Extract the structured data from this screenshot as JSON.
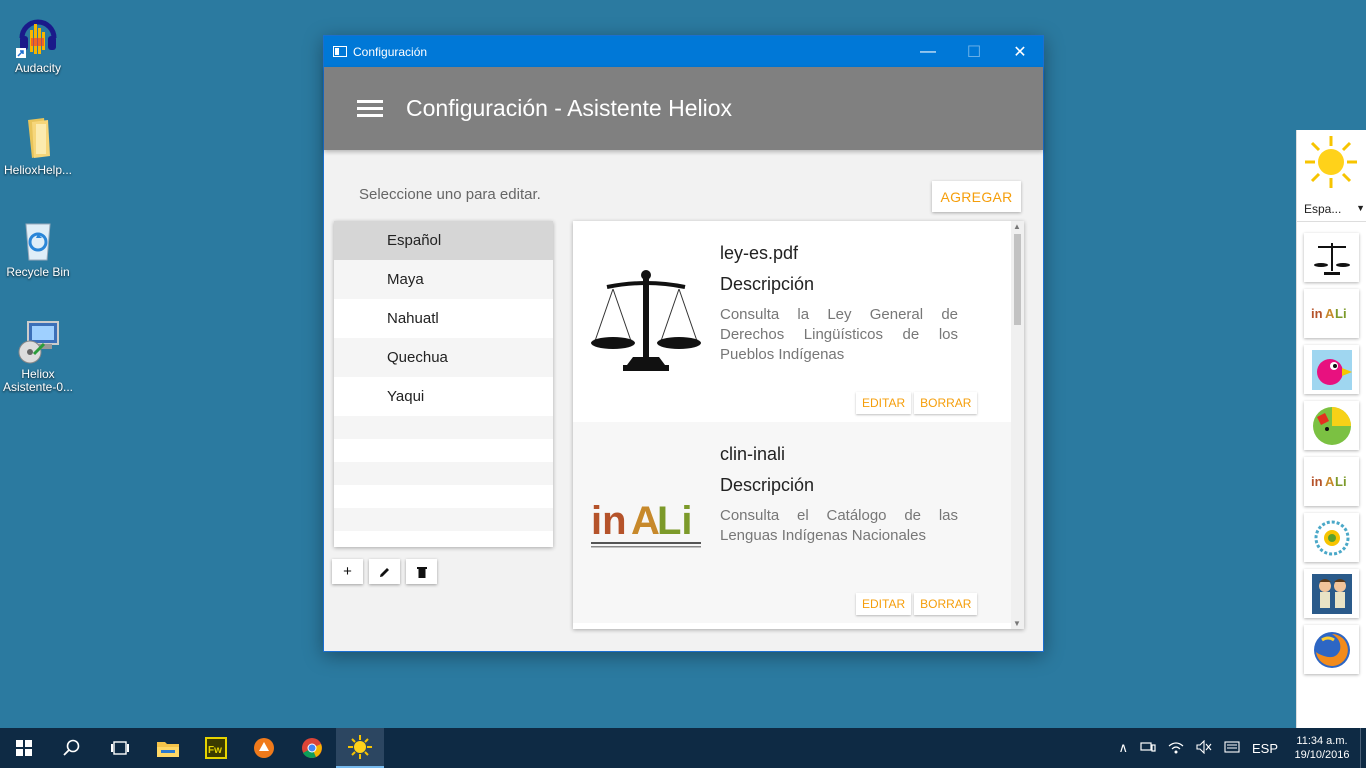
{
  "desktop": {
    "icons": [
      {
        "label": "Audacity"
      },
      {
        "label": "HelioxHelp..."
      },
      {
        "label": "Recycle Bin"
      },
      {
        "label": "Heliox Asistente-0..."
      }
    ]
  },
  "window": {
    "title": "Configuración",
    "controls": {
      "minimize": "—",
      "maximize": "☐",
      "close": "✕"
    },
    "app_title": "Configuración - Asistente Heliox",
    "hint": "Seleccione uno para editar.",
    "add_label": "AGREGAR",
    "languages": [
      "Español",
      "Maya",
      "Nahuatl",
      "Quechua",
      "Yaqui"
    ],
    "selected_language": "Español",
    "tools": {
      "add": "+",
      "edit": "✎",
      "delete": "🗑"
    },
    "cards": [
      {
        "filename": "ley-es.pdf",
        "desc_label": "Descripción",
        "description": "Consulta la Ley General de Derechos Lingüísticos de los Pueblos Indígenas",
        "edit": "EDITAR",
        "delete": "BORRAR"
      },
      {
        "filename": "clin-inali",
        "desc_label": "Descripción",
        "description": "Consulta el Catálogo de las Lenguas Indígenas Nacionales",
        "edit": "EDITAR",
        "delete": "BORRAR"
      }
    ],
    "accent_color": "#f59e0b",
    "appbar_color": "#808080"
  },
  "dock": {
    "language": "Espa..."
  },
  "taskbar": {
    "lang": "ESP",
    "time": "11:34 a.m.",
    "date": "19/10/2016"
  }
}
